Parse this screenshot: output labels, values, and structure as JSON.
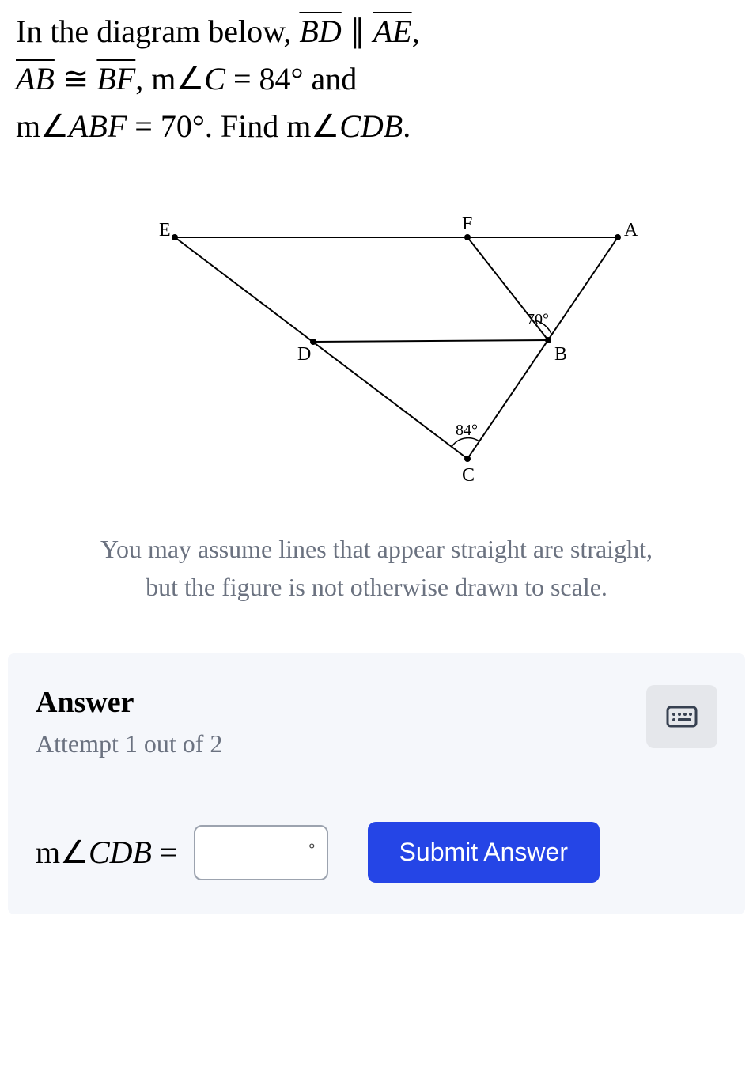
{
  "problem": {
    "line1_prefix": "In the diagram below,  ",
    "seg1": "BD",
    "parallel": " ∥ ",
    "seg2": "AE",
    "comma1": ",",
    "seg3": "AB",
    "cong": " ≅ ",
    "seg4": "BF",
    "comma2": ",   ",
    "angleC_prefix": "m∠",
    "angleC_var": "C",
    "angleC_eq": " = 84° and",
    "angleABF_prefix": "m∠",
    "angleABF_var": "ABF",
    "angleABF_eq": " = 70°. Find m∠",
    "angleCDB_var": "CDB",
    "period": "."
  },
  "diagram": {
    "labels": {
      "E": "E",
      "F": "F",
      "A": "A",
      "D": "D",
      "B": "B",
      "C": "C",
      "angle70": "70°",
      "angle84": "84°"
    }
  },
  "note": {
    "line1": "You may assume lines that appear straight are straight,",
    "line2": "but the figure is not otherwise drawn to scale."
  },
  "answer": {
    "title": "Answer",
    "attempt": "Attempt 1 out of 2",
    "label_prefix": "m∠",
    "label_var": "CDB",
    "label_eq": " =",
    "degree": "∘",
    "submit": "Submit Answer",
    "value": ""
  }
}
